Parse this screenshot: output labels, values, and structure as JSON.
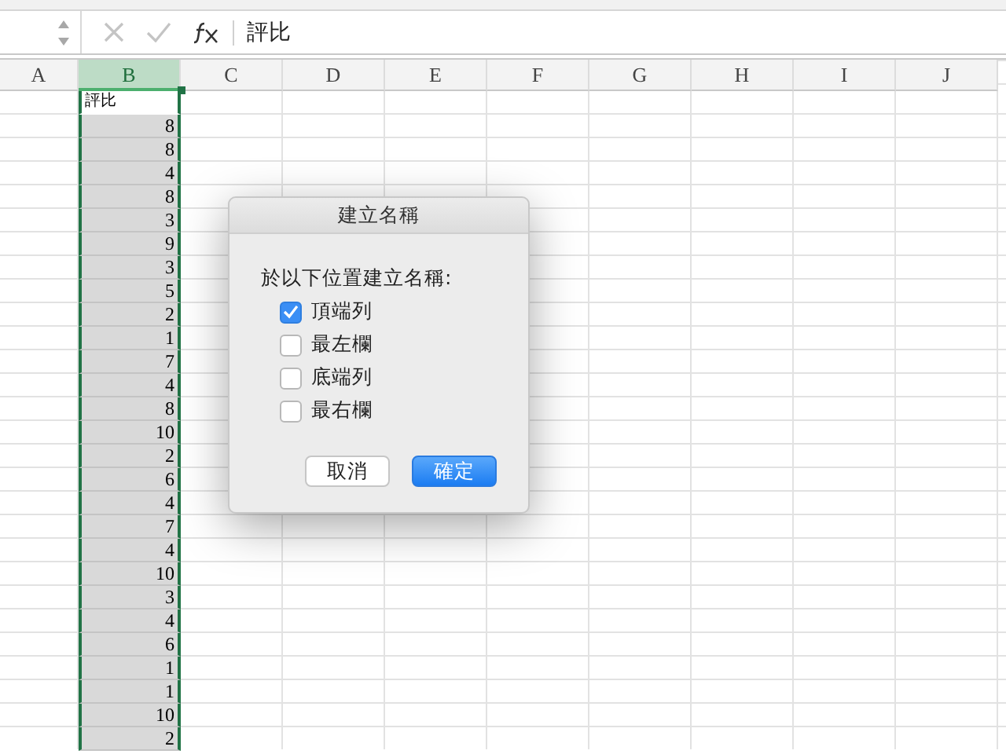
{
  "formula_bar": {
    "content": "評比"
  },
  "columns": [
    {
      "label": "A",
      "selected": false
    },
    {
      "label": "B",
      "selected": true
    },
    {
      "label": "C",
      "selected": false
    },
    {
      "label": "D",
      "selected": false
    },
    {
      "label": "E",
      "selected": false
    },
    {
      "label": "F",
      "selected": false
    },
    {
      "label": "G",
      "selected": false
    },
    {
      "label": "H",
      "selected": false
    },
    {
      "label": "I",
      "selected": false
    },
    {
      "label": "J",
      "selected": false
    }
  ],
  "column_b_cells": [
    {
      "value": "評比",
      "kind": "text"
    },
    {
      "value": "8",
      "kind": "number"
    },
    {
      "value": "8",
      "kind": "number"
    },
    {
      "value": "4",
      "kind": "number"
    },
    {
      "value": "8",
      "kind": "number"
    },
    {
      "value": "3",
      "kind": "number"
    },
    {
      "value": "9",
      "kind": "number"
    },
    {
      "value": "3",
      "kind": "number"
    },
    {
      "value": "5",
      "kind": "number"
    },
    {
      "value": "2",
      "kind": "number"
    },
    {
      "value": "1",
      "kind": "number"
    },
    {
      "value": "7",
      "kind": "number"
    },
    {
      "value": "4",
      "kind": "number"
    },
    {
      "value": "8",
      "kind": "number"
    },
    {
      "value": "10",
      "kind": "number"
    },
    {
      "value": "2",
      "kind": "number"
    },
    {
      "value": "6",
      "kind": "number"
    },
    {
      "value": "4",
      "kind": "number"
    },
    {
      "value": "7",
      "kind": "number"
    },
    {
      "value": "4",
      "kind": "number"
    },
    {
      "value": "10",
      "kind": "number"
    },
    {
      "value": "3",
      "kind": "number"
    },
    {
      "value": "4",
      "kind": "number"
    },
    {
      "value": "6",
      "kind": "number"
    },
    {
      "value": "1",
      "kind": "number"
    },
    {
      "value": "1",
      "kind": "number"
    },
    {
      "value": "10",
      "kind": "number"
    },
    {
      "value": "2",
      "kind": "number"
    }
  ],
  "dialog": {
    "title": "建立名稱",
    "prompt": "於以下位置建立名稱:",
    "options": [
      {
        "label": "頂端列",
        "checked": true
      },
      {
        "label": "最左欄",
        "checked": false
      },
      {
        "label": "底端列",
        "checked": false
      },
      {
        "label": "最右欄",
        "checked": false
      }
    ],
    "buttons": [
      {
        "label": "取消",
        "kind": "secondary"
      },
      {
        "label": "確定",
        "kind": "primary"
      }
    ]
  }
}
